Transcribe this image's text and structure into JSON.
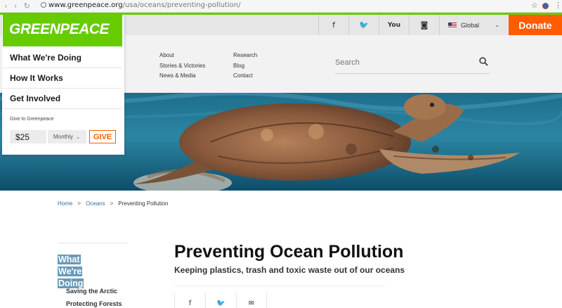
{
  "browser": {
    "nav_glyphs": "‹ › ↻",
    "url_host": "www.greenpeace.org",
    "url_path": "/usa/oceans/preventing-pollution/",
    "star_glyph": "☆",
    "menu_glyph": "⋮"
  },
  "topbar": {
    "social": [
      {
        "name": "facebook-icon",
        "glyph": "f"
      },
      {
        "name": "twitter-icon",
        "glyph": "🐦"
      },
      {
        "name": "youtube-icon",
        "glyph": "You"
      },
      {
        "name": "instagram-icon",
        "glyph": "◙"
      }
    ],
    "region_label": "Global",
    "donate_label": "Donate"
  },
  "colors": {
    "brand_green": "#66cc00",
    "donate_orange": "#ff5c00",
    "link_blue": "#3a6f9a",
    "highlight": "#6a9ab8"
  },
  "logo": {
    "text": "GREENPEACE"
  },
  "menu": {
    "items": [
      "What We're Doing",
      "How It Works",
      "Get Involved"
    ]
  },
  "donation": {
    "label": "Give to Greenpeace",
    "amount": "$25",
    "frequency": "Monthly",
    "give_label": "GIVE"
  },
  "header_nav": {
    "col1": [
      "About",
      "Stories & Victories",
      "News & Media"
    ],
    "col2": [
      "Research",
      "Blog",
      "Contact"
    ]
  },
  "search": {
    "placeholder": "Search"
  },
  "breadcrumb": {
    "items": [
      "Home",
      "Oceans",
      "Preventing Pollution"
    ],
    "separator": ">"
  },
  "sidebar": {
    "heading": "What We're Doing",
    "links": [
      "Saving the Arctic",
      "Protecting Forests"
    ]
  },
  "article": {
    "title": "Preventing Ocean Pollution",
    "subtitle": "Keeping plastics, trash and toxic waste out of our oceans"
  },
  "share": [
    {
      "name": "share-facebook-icon",
      "glyph": "f"
    },
    {
      "name": "share-twitter-icon",
      "glyph": "🐦"
    },
    {
      "name": "share-email-icon",
      "glyph": "✉"
    }
  ]
}
